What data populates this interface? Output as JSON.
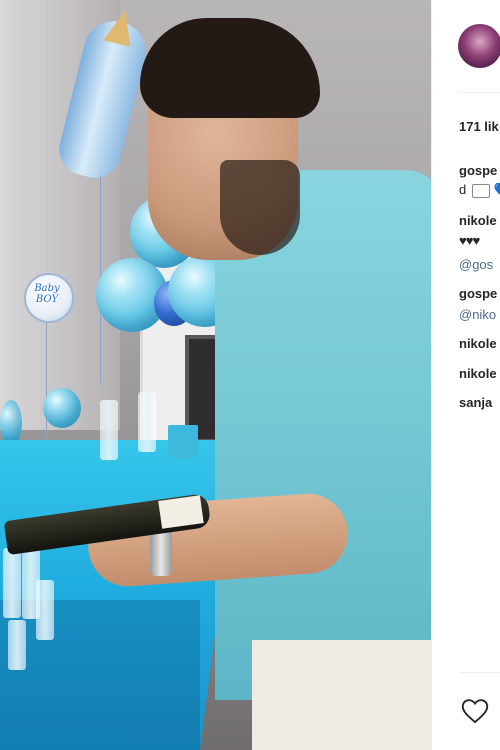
{
  "post": {
    "likes": "171 lik",
    "comments": [
      {
        "user": "gospe",
        "text": ""
      },
      {
        "user": "",
        "text": "d",
        "emoji": "💙"
      },
      {
        "user": "nikole",
        "text": ""
      },
      {
        "user": "",
        "text": "",
        "hearts": "♥♥♥"
      },
      {
        "user": "",
        "mention": "@gos"
      },
      {
        "user": "gospe",
        "text": ""
      },
      {
        "user": "",
        "mention": "@niko"
      },
      {
        "user": "nikole",
        "text": ""
      },
      {
        "user": "nikole",
        "text": ""
      },
      {
        "user": "sanja",
        "text": ""
      }
    ]
  },
  "balloon_text": {
    "line1": "Baby",
    "line2": "BOY"
  },
  "icons": [
    "avatar",
    "heart-icon"
  ],
  "colors": {
    "text": "#262626",
    "border": "#efefef",
    "accent_blue": "#3897f0"
  }
}
